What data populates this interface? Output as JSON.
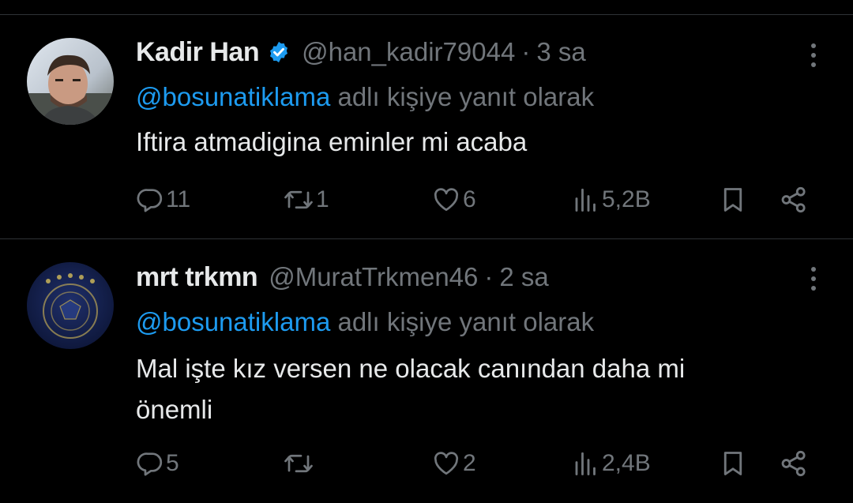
{
  "colors": {
    "background": "#000000",
    "text": "#e7e9ea",
    "muted": "#71767b",
    "link": "#1d9bf0",
    "divider": "#2f3336",
    "verified": "#1d9bf0"
  },
  "tweets": [
    {
      "name": "Kadir Han",
      "verified": true,
      "handle": "@han_kadir79044",
      "separator": "·",
      "time": "3 sa",
      "reply_mention": "@bosunatiklama",
      "reply_suffix": " adlı kişiye yanıt olarak",
      "text": "Iftira atmadigina eminler mi acaba",
      "stats": {
        "replies": "11",
        "reposts": "1",
        "likes": "6",
        "views": "5,2B"
      },
      "icons": [
        "reply-icon",
        "repost-icon",
        "like-icon",
        "views-icon",
        "bookmark-icon",
        "share-icon"
      ]
    },
    {
      "name": "mrt trkmn",
      "verified": false,
      "handle": "@MuratTrkmen46",
      "separator": "·",
      "time": "2 sa",
      "reply_mention": "@bosunatiklama",
      "reply_suffix": " adlı kişiye yanıt olarak",
      "text_line1": "Mal işte kız versen ne olacak canından daha mi",
      "text_line2": "önemli",
      "stats": {
        "replies": "5",
        "reposts": "",
        "likes": "2",
        "views": "2,4B"
      },
      "icons": [
        "reply-icon",
        "repost-icon",
        "like-icon",
        "views-icon",
        "bookmark-icon",
        "share-icon"
      ]
    }
  ]
}
